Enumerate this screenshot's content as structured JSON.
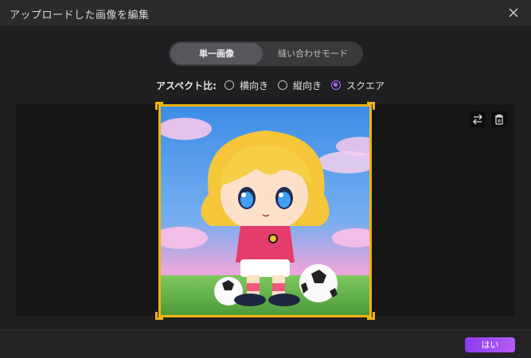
{
  "window": {
    "title": "アップロードした画像を編集",
    "close_icon": "close-icon"
  },
  "mode_switch": {
    "options": [
      {
        "label": "単一画像",
        "selected": true
      },
      {
        "label": "縫い合わせモード",
        "selected": false
      }
    ]
  },
  "aspect_ratio": {
    "label": "アスペクト比:",
    "options": [
      {
        "label": "横向き",
        "checked": false
      },
      {
        "label": "縦向き",
        "checked": false
      },
      {
        "label": "スクエア",
        "checked": true
      }
    ]
  },
  "editor": {
    "tools": [
      {
        "name": "swap-icon"
      },
      {
        "name": "trash-icon"
      }
    ],
    "selection_color": "#f2b415"
  },
  "footer": {
    "confirm_label": "はい",
    "accent": "#9b45f3"
  }
}
